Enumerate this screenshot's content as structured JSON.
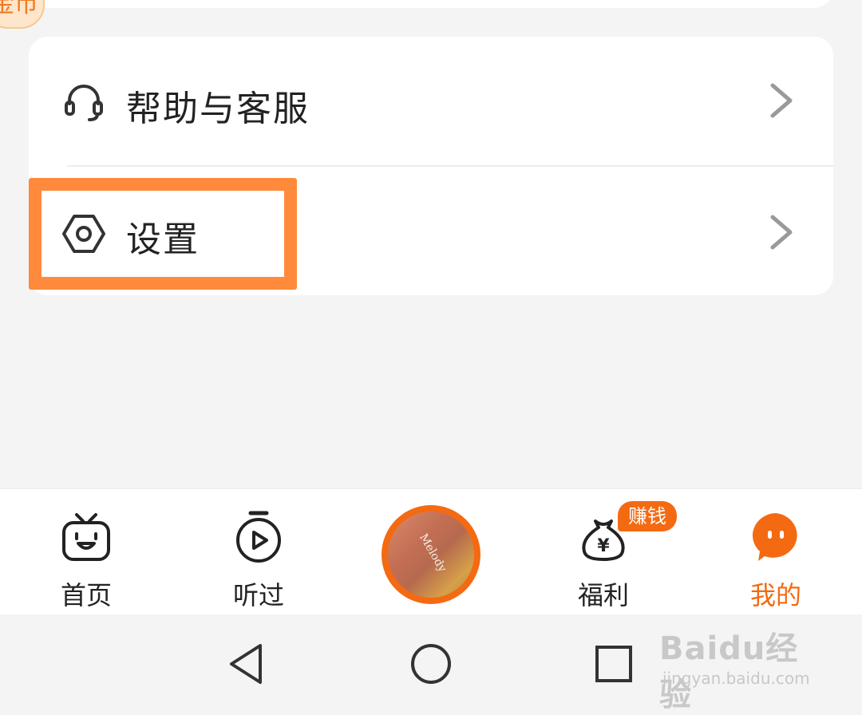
{
  "top": {
    "coin_badge_text": "金币"
  },
  "menu": {
    "items": [
      {
        "label": "帮助与客服",
        "icon": "headset-icon"
      },
      {
        "label": "设置",
        "icon": "hexagon-gear-icon"
      }
    ]
  },
  "tabbar": {
    "tabs": [
      {
        "label": "首页",
        "icon": "tv-face-icon"
      },
      {
        "label": "听过",
        "icon": "stopwatch-play-icon"
      },
      {
        "label": "福利",
        "icon": "money-bag-icon",
        "badge": "赚钱"
      },
      {
        "label": "我的",
        "icon": "chat-face-icon",
        "active": true
      }
    ],
    "center_cover_title": "Melody"
  },
  "colors": {
    "accent": "#f46a12",
    "highlight": "#ff8a3c",
    "background": "#f4f4f4",
    "card": "#ffffff"
  },
  "navbar": {
    "buttons": [
      "back-icon",
      "home-circle-icon",
      "recent-apps-icon"
    ]
  },
  "watermark": {
    "main": "Baidu经验",
    "sub": "jingyan.baidu.com"
  }
}
